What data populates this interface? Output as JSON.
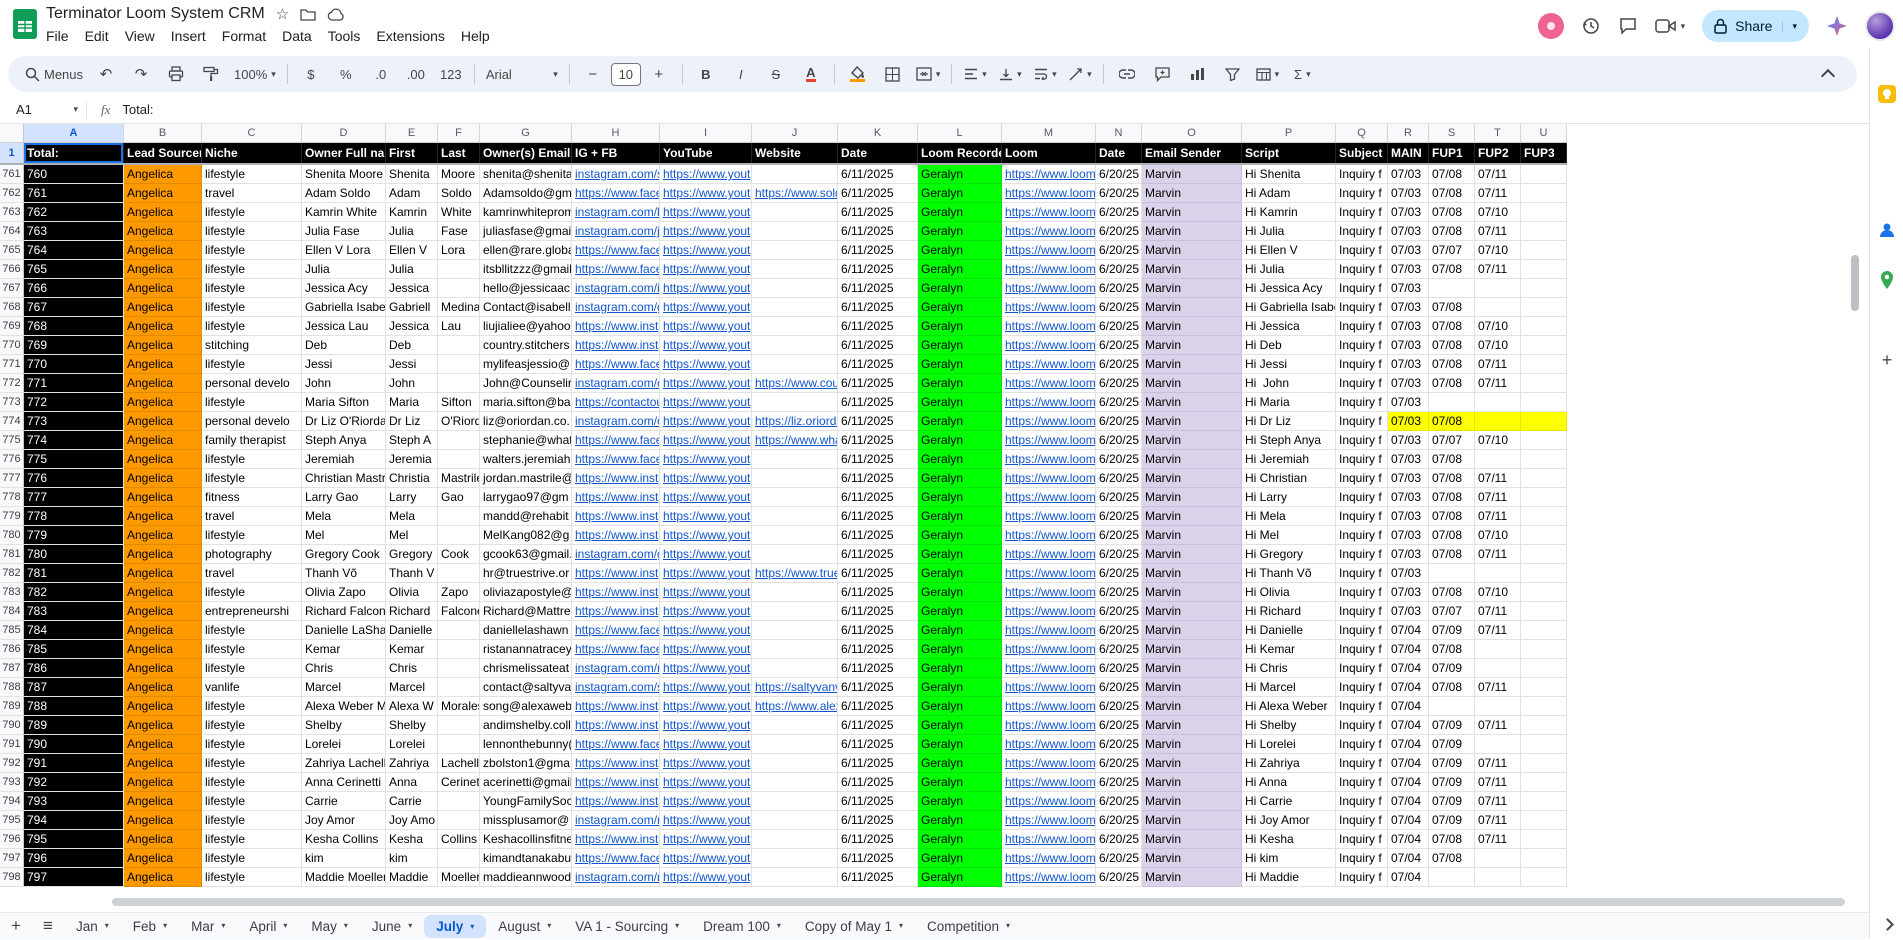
{
  "titlebar": {
    "title": "Terminator Loom System CRM",
    "menus": [
      "File",
      "Edit",
      "View",
      "Insert",
      "Format",
      "Data",
      "Tools",
      "Extensions",
      "Help"
    ],
    "share_label": "Share"
  },
  "toolbar": {
    "menus_label": "Menus",
    "zoom": "100%",
    "currency": "$",
    "percent": "%",
    "dec0": ".0",
    "dec00": ".00",
    "fmt123": "123",
    "font": "Arial",
    "size": "10",
    "bold": "B",
    "italic": "I",
    "strike": "S",
    "color": "A",
    "sigma": "Σ"
  },
  "formula": {
    "cell_ref": "A1",
    "fx_label": "fx",
    "value": "Total:"
  },
  "grid": {
    "letters": [
      "A",
      "B",
      "C",
      "D",
      "E",
      "F",
      "G",
      "H",
      "I",
      "J",
      "K",
      "L",
      "M",
      "N",
      "O",
      "P",
      "Q",
      "R",
      "S",
      "T",
      "U"
    ],
    "frozen_row": "1",
    "headers": [
      "Total:",
      "Lead Sourcer",
      "Niche",
      "Owner Full name",
      "First",
      "Last",
      "Owner(s) Email",
      "IG + FB",
      "YouTube",
      "Website",
      "Date",
      "Loom Recorder",
      "Loom",
      "Date",
      "Email Sender",
      "Script",
      "Subject",
      "MAIN",
      "FUP1",
      "FUP2",
      "FUP3"
    ],
    "row_defaults": {
      "b": "Angelica",
      "yt": "https://www.yout",
      "date": "6/11/2025",
      "recorder": "Geralyn",
      "loom": "https://www.loom",
      "date2": "6/20/25",
      "sender": "Marvin",
      "subject": "Inquiry f",
      "f3": ""
    },
    "rows": [
      {
        "n": "761",
        "a": "760",
        "niche": "lifestyle",
        "owner": "Shenita Moore",
        "first": "Shenita",
        "last": "Moore",
        "email": "shenita@shenita",
        "ig": "instagram.com/s",
        "web": "",
        "script": "Hi Shenita",
        "main": "07/03",
        "f1": "07/08",
        "f2": "07/11"
      },
      {
        "n": "762",
        "a": "761",
        "niche": "travel",
        "owner": "Adam Soldo",
        "first": "Adam",
        "last": "Soldo",
        "email": "Adamsoldo@gm",
        "ig": "https://www.face",
        "web": "https://www.sold",
        "script": "Hi Adam",
        "main": "07/03",
        "f1": "07/08",
        "f2": "07/11"
      },
      {
        "n": "763",
        "a": "762",
        "niche": "lifestyle",
        "owner": "Kamrin White",
        "first": "Kamrin",
        "last": "White",
        "email": "kamrinwhiteprom",
        "ig": "instagram.com/k",
        "web": "",
        "script": "Hi Kamrin",
        "main": "07/03",
        "f1": "07/08",
        "f2": "07/10"
      },
      {
        "n": "764",
        "a": "763",
        "niche": "lifestyle",
        "owner": "Julia Fase",
        "first": "Julia",
        "last": "Fase",
        "email": "juliasfase@gmai",
        "ig": "instagram.com/ju",
        "web": "",
        "script": "Hi Julia",
        "main": "07/03",
        "f1": "07/08",
        "f2": "07/11"
      },
      {
        "n": "765",
        "a": "764",
        "niche": "lifestyle",
        "owner": "Ellen V Lora",
        "first": "Ellen V",
        "last": "Lora",
        "email": "ellen@rare.globa",
        "ig": "https://www.face",
        "web": "",
        "script": "Hi Ellen V",
        "main": "07/03",
        "f1": "07/07",
        "f2": "07/10"
      },
      {
        "n": "766",
        "a": "765",
        "niche": "lifestyle",
        "owner": "Julia",
        "first": "Julia",
        "last": "",
        "email": "itsbllitzzz@gmail.",
        "ig": "https://www.face",
        "web": "",
        "script": "Hi Julia",
        "main": "07/03",
        "f1": "07/08",
        "f2": "07/11"
      },
      {
        "n": "767",
        "a": "766",
        "niche": "lifestyle",
        "owner": "Jessica Acy",
        "first": "Jessica",
        "last": "",
        "email": "hello@jessicaac",
        "ig": "instagram.com/it",
        "web": "",
        "script": "Hi Jessica Acy",
        "main": "07/03",
        "f1": "",
        "f2": ""
      },
      {
        "n": "768",
        "a": "767",
        "niche": "lifestyle",
        "owner": "Gabriella Isabell",
        "first": "Gabriell",
        "last": "Medina",
        "email": "Contact@isabell",
        "ig": "instagram.com/g",
        "web": "",
        "script": "Hi Gabriella Isabel",
        "main": "07/03",
        "f1": "07/08",
        "f2": ""
      },
      {
        "n": "769",
        "a": "768",
        "niche": "lifestyle",
        "owner": "Jessica Lau",
        "first": "Jessica",
        "last": "Lau",
        "email": "liujialiee@yahoo",
        "ig": "https://www.inst",
        "web": "",
        "script": "Hi Jessica",
        "main": "07/03",
        "f1": "07/08",
        "f2": "07/10"
      },
      {
        "n": "770",
        "a": "769",
        "niche": "stitching",
        "owner": "Deb",
        "first": "Deb",
        "last": "",
        "email": "country.stitchers",
        "ig": "https://www.inst",
        "web": "",
        "script": "Hi Deb",
        "main": "07/03",
        "f1": "07/08",
        "f2": "07/10"
      },
      {
        "n": "771",
        "a": "770",
        "niche": "lifestyle",
        "owner": "Jessi",
        "first": "Jessi",
        "last": "",
        "email": "mylifeasjessio@",
        "ig": "https://www.face",
        "web": "",
        "script": "Hi Jessi",
        "main": "07/03",
        "f1": "07/08",
        "f2": "07/11"
      },
      {
        "n": "772",
        "a": "771",
        "niche": "personal develo",
        "owner": "John",
        "first": "John",
        "last": "",
        "email": "John@Counselir",
        "ig": "instagram.com/c",
        "web": "https://www.cour",
        "script": "Hi  John",
        "main": "07/03",
        "f1": "07/08",
        "f2": "07/11"
      },
      {
        "n": "773",
        "a": "772",
        "niche": "lifestyle",
        "owner": "Maria Sifton",
        "first": "Maria",
        "last": "Sifton",
        "email": "maria.sifton@ba",
        "ig": "https://contactou",
        "web": "",
        "script": "Hi Maria",
        "main": "07/03",
        "f1": "",
        "f2": ""
      },
      {
        "n": "774",
        "a": "773",
        "niche": "personal develo",
        "owner": "Dr Liz O'Riordan",
        "first": "Dr Liz",
        "last": "O'Riord",
        "email": "liz@oriordan.co.",
        "ig": "instagram.com/o",
        "web": "https://liz.oriorda",
        "script": "Hi Dr Liz",
        "main": "07/03",
        "f1": "07/08",
        "f2": "",
        "hl": true
      },
      {
        "n": "775",
        "a": "774",
        "niche": "family therapist",
        "owner": "Steph Anya",
        "first": "Steph A",
        "last": "",
        "email": "stephanie@what",
        "ig": "https://www.face",
        "web": "https://www.what",
        "script": "Hi Steph Anya",
        "main": "07/03",
        "f1": "07/07",
        "f2": "07/10"
      },
      {
        "n": "776",
        "a": "775",
        "niche": "lifestyle",
        "owner": "Jeremiah",
        "first": "Jeremia",
        "last": "",
        "email": "walters.jeremiah",
        "ig": "https://www.face",
        "web": "",
        "script": "Hi Jeremiah",
        "main": "07/03",
        "f1": "07/08",
        "f2": ""
      },
      {
        "n": "777",
        "a": "776",
        "niche": "lifestyle",
        "owner": "Christian Mastril",
        "first": "Christia",
        "last": "Mastrile",
        "email": "jordan.mastrile@",
        "ig": "https://www.inst",
        "web": "",
        "script": "Hi Christian",
        "main": "07/03",
        "f1": "07/08",
        "f2": "07/11"
      },
      {
        "n": "778",
        "a": "777",
        "niche": "fitness",
        "owner": "Larry Gao",
        "first": "Larry",
        "last": "Gao",
        "email": "larrygao97@gm",
        "ig": "https://www.inst",
        "web": "",
        "script": "Hi Larry",
        "main": "07/03",
        "f1": "07/08",
        "f2": "07/11"
      },
      {
        "n": "779",
        "a": "778",
        "niche": "travel",
        "owner": "Mela",
        "first": "Mela",
        "last": "",
        "email": "mandd@rehabit",
        "ig": "https://www.inst",
        "web": "",
        "script": "Hi Mela",
        "main": "07/03",
        "f1": "07/08",
        "f2": "07/11"
      },
      {
        "n": "780",
        "a": "779",
        "niche": "lifestyle",
        "owner": "Mel",
        "first": "Mel",
        "last": "",
        "email": "MelKang082@g",
        "ig": "https://www.inst",
        "web": "",
        "script": "Hi Mel",
        "main": "07/03",
        "f1": "07/08",
        "f2": "07/10"
      },
      {
        "n": "781",
        "a": "780",
        "niche": "photography",
        "owner": "Gregory Cook",
        "first": "Gregory",
        "last": "Cook",
        "email": "gcook63@gmail.",
        "ig": "instagram.com/g",
        "web": "",
        "script": "Hi Gregory",
        "main": "07/03",
        "f1": "07/08",
        "f2": "07/11"
      },
      {
        "n": "782",
        "a": "781",
        "niche": "travel",
        "owner": "Thanh Võ",
        "first": "Thanh V",
        "last": "",
        "email": "hr@truestrive.or",
        "ig": "https://www.inst",
        "web": "https://www.true",
        "script": "Hi Thanh Võ",
        "main": "07/03",
        "f1": "",
        "f2": ""
      },
      {
        "n": "783",
        "a": "782",
        "niche": "lifestyle",
        "owner": "Olivia Zapo",
        "first": "Olivia",
        "last": "Zapo",
        "email": "oliviazapostyle@",
        "ig": "https://www.inst",
        "web": "",
        "script": "Hi Olivia",
        "main": "07/03",
        "f1": "07/08",
        "f2": "07/10"
      },
      {
        "n": "784",
        "a": "783",
        "niche": "entrepreneurshi",
        "owner": "Richard Falcone",
        "first": "Richard",
        "last": "Falcone",
        "email": "Richard@Mattre",
        "ig": "https://www.inst",
        "web": "",
        "script": "Hi Richard",
        "main": "07/03",
        "f1": "07/07",
        "f2": "07/11"
      },
      {
        "n": "785",
        "a": "784",
        "niche": "lifestyle",
        "owner": "Danielle LaShaw",
        "first": "Danielle",
        "last": "",
        "email": "daniellelashawn",
        "ig": "https://www.face",
        "web": "",
        "script": "Hi Danielle",
        "main": "07/04",
        "f1": "07/09",
        "f2": "07/11"
      },
      {
        "n": "786",
        "a": "785",
        "niche": "lifestyle",
        "owner": "Kemar",
        "first": "Kemar",
        "last": "",
        "email": "ristanannatracey",
        "ig": "https://www.face",
        "web": "",
        "script": "Hi Kemar",
        "main": "07/04",
        "f1": "07/08",
        "f2": ""
      },
      {
        "n": "787",
        "a": "786",
        "niche": "lifestyle",
        "owner": "Chris",
        "first": "Chris",
        "last": "",
        "email": "chrismelissateat",
        "ig": "instagram.com/n",
        "web": "",
        "script": "Hi Chris",
        "main": "07/04",
        "f1": "07/09",
        "f2": ""
      },
      {
        "n": "788",
        "a": "787",
        "niche": "vanlife",
        "owner": "Marcel",
        "first": "Marcel",
        "last": "",
        "email": "contact@saltyva",
        "ig": "instagram.com/s",
        "web": "https://saltyvanv",
        "script": "Hi Marcel",
        "main": "07/04",
        "f1": "07/08",
        "f2": "07/11"
      },
      {
        "n": "789",
        "a": "788",
        "niche": "lifestyle",
        "owner": "Alexa Weber Mo",
        "first": "Alexa W",
        "last": "Morales",
        "email": "song@alexaweb",
        "ig": "https://www.inst",
        "web": "https://www.alex",
        "script": "Hi Alexa Weber",
        "main": "07/04",
        "f1": "",
        "f2": ""
      },
      {
        "n": "790",
        "a": "789",
        "niche": "lifestyle",
        "owner": "Shelby",
        "first": "Shelby",
        "last": "",
        "email": "andimshelby.coll",
        "ig": "https://www.inst",
        "web": "",
        "script": "Hi Shelby",
        "main": "07/04",
        "f1": "07/09",
        "f2": "07/11"
      },
      {
        "n": "791",
        "a": "790",
        "niche": "lifestyle",
        "owner": "Lorelei",
        "first": "Lorelei",
        "last": "",
        "email": "lennonthebunny(",
        "ig": "https://www.face",
        "web": "",
        "script": "Hi Lorelei",
        "main": "07/04",
        "f1": "07/09",
        "f2": ""
      },
      {
        "n": "792",
        "a": "791",
        "niche": "lifestyle",
        "owner": "Zahriya Lachell",
        "first": "Zahriya",
        "last": "Lachell",
        "email": "zbolston1@gma",
        "ig": "https://www.inst",
        "web": "",
        "script": "Hi Zahriya",
        "main": "07/04",
        "f1": "07/09",
        "f2": "07/11"
      },
      {
        "n": "793",
        "a": "792",
        "niche": "lifestyle",
        "owner": "Anna Cerinetti",
        "first": "Anna",
        "last": "Cerinett",
        "email": "acerinetti@gmail",
        "ig": "https://www.inst",
        "web": "",
        "script": "Hi Anna",
        "main": "07/04",
        "f1": "07/09",
        "f2": "07/11"
      },
      {
        "n": "794",
        "a": "793",
        "niche": "lifestyle",
        "owner": "Carrie",
        "first": "Carrie",
        "last": "",
        "email": "YoungFamilySoc",
        "ig": "https://www.inst",
        "web": "",
        "script": "Hi Carrie",
        "main": "07/04",
        "f1": "07/09",
        "f2": "07/11"
      },
      {
        "n": "795",
        "a": "794",
        "niche": "lifestyle",
        "owner": "Joy Amor",
        "first": "Joy Amo",
        "last": "",
        "email": "missplusamor@",
        "ig": "instagram.com/n",
        "web": "",
        "script": "Hi Joy Amor",
        "main": "07/04",
        "f1": "07/09",
        "f2": "07/11"
      },
      {
        "n": "796",
        "a": "795",
        "niche": "lifestyle",
        "owner": "Kesha Collins",
        "first": "Kesha",
        "last": "Collins",
        "email": "Keshacollinsfitne",
        "ig": "https://www.inst",
        "web": "",
        "script": "Hi Kesha",
        "main": "07/04",
        "f1": "07/08",
        "f2": "07/11"
      },
      {
        "n": "797",
        "a": "796",
        "niche": "lifestyle",
        "owner": "kim",
        "first": "kim",
        "last": "",
        "email": "kimandtanakabu",
        "ig": "https://www.face",
        "web": "",
        "script": "Hi kim",
        "main": "07/04",
        "f1": "07/08",
        "f2": ""
      },
      {
        "n": "798",
        "a": "797",
        "niche": "lifestyle",
        "owner": "Maddie Moeller",
        "first": "Maddie",
        "last": "Moeller",
        "email": "maddieannwood",
        "ig": "instagram.com/n",
        "web": "",
        "script": "Hi Maddie",
        "main": "07/04",
        "f1": "",
        "f2": ""
      }
    ]
  },
  "tabs": {
    "active": "July",
    "items": [
      "Jan",
      "Feb",
      "Mar",
      "April",
      "May",
      "June",
      "July",
      "August",
      "VA 1 - Sourcing",
      "Dream 100",
      "Copy of May 1",
      "Competition"
    ]
  },
  "colors": {
    "link": "#1155cc",
    "col_a_bg": "#000000",
    "lead_sourcer_bg": "#ff9900",
    "loom_recorder_bg": "#00ff00",
    "email_sender_bg": "#d9d2e9",
    "row_highlight": "#ffff00",
    "active_tab": "#0b57d0",
    "share_bg": "#c2e7ff"
  }
}
